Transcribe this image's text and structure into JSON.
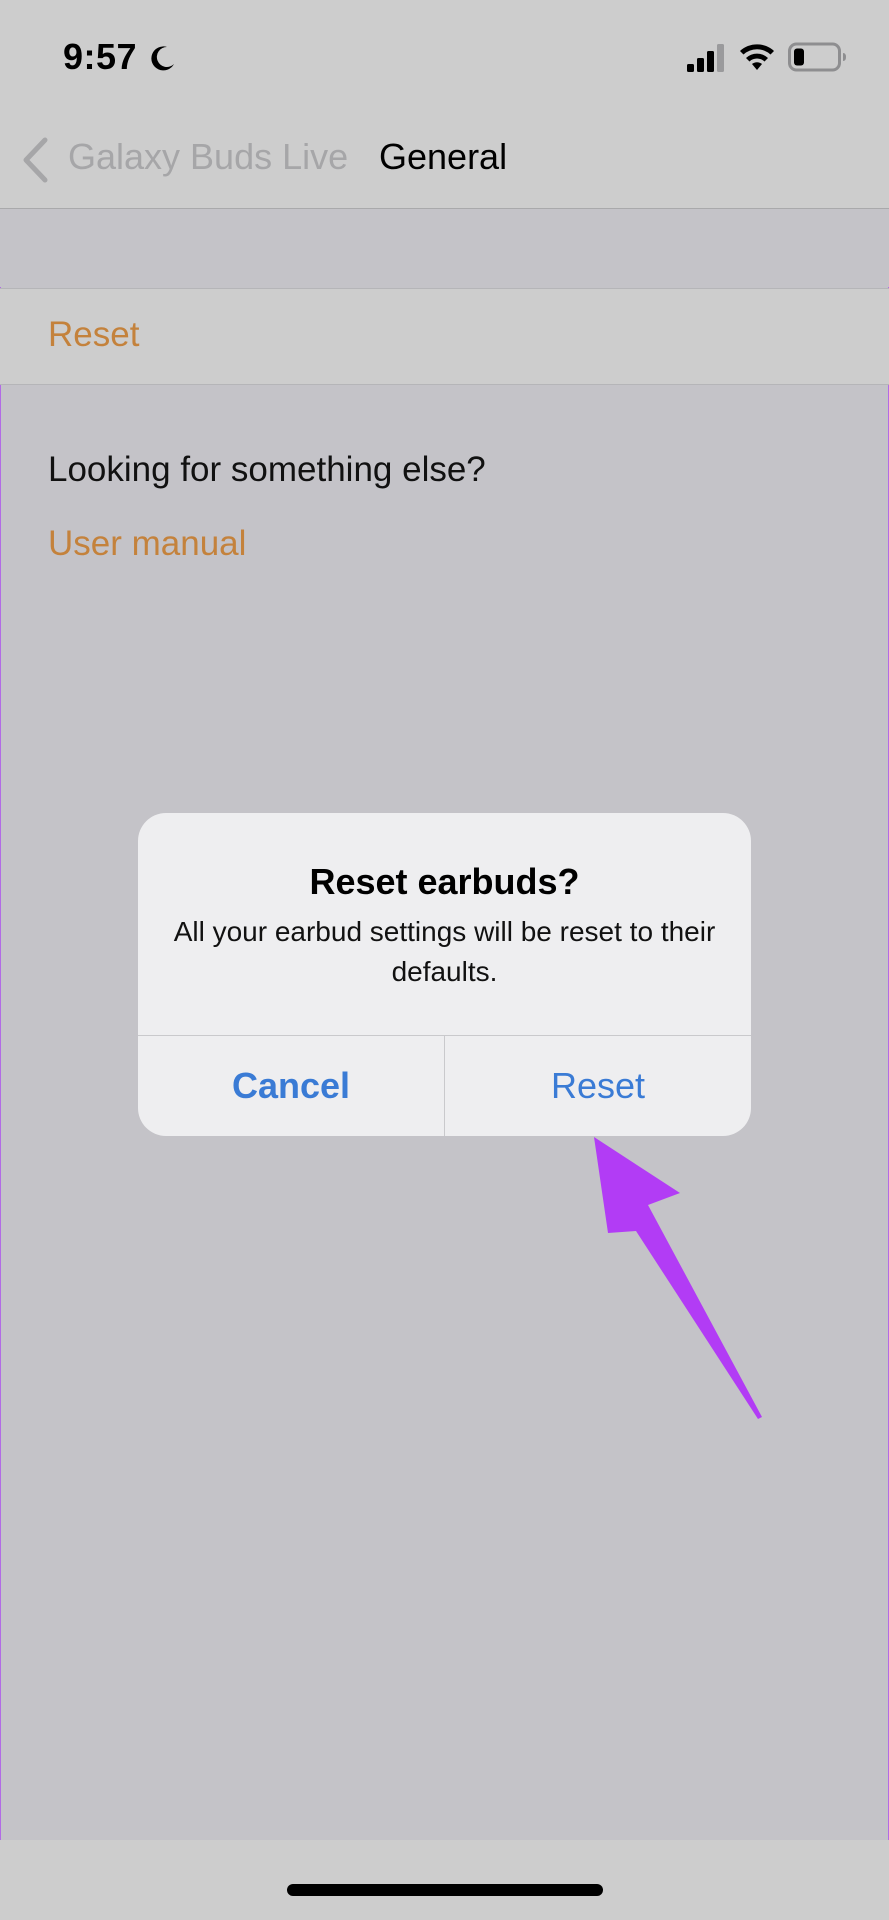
{
  "status_bar": {
    "time": "9:57",
    "moon_icon": "moon-icon",
    "signal_icon": "cellular-signal-icon",
    "wifi_icon": "wifi-icon",
    "battery_icon": "battery-icon"
  },
  "nav": {
    "back_label": "Galaxy Buds Live",
    "title": "General"
  },
  "list": {
    "reset_label": "Reset"
  },
  "help": {
    "prompt": "Looking for something else?",
    "link": "User manual"
  },
  "alert": {
    "title": "Reset earbuds?",
    "message": "All your earbud settings will be reset to their defaults.",
    "cancel_label": "Cancel",
    "confirm_label": "Reset"
  },
  "colors": {
    "accent_orange": "#c4823c",
    "alert_button_blue": "#3a7bd5",
    "annotation_purple": "#b23cf5"
  }
}
